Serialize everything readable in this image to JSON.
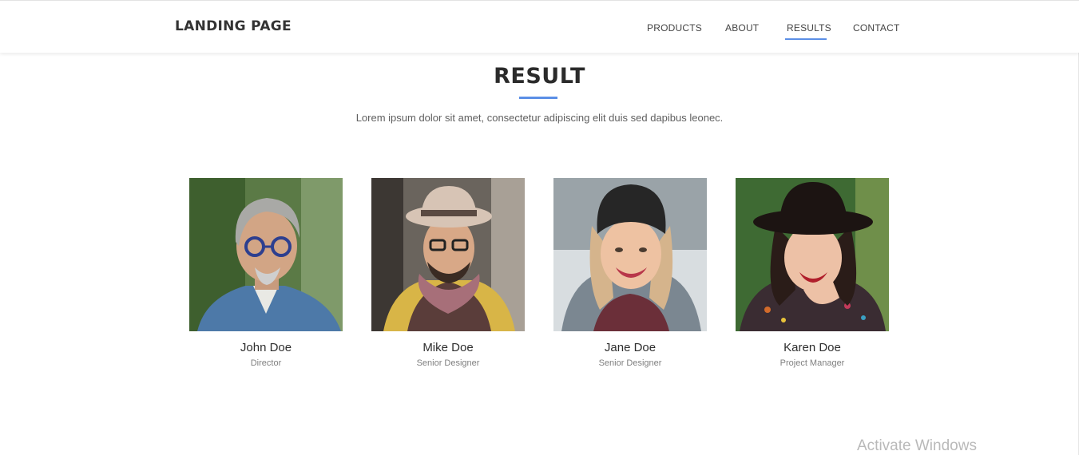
{
  "header": {
    "brand": "LANDING PAGE",
    "nav": [
      {
        "label": "PRODUCTS",
        "active": false
      },
      {
        "label": "ABOUT",
        "active": false
      },
      {
        "label": "RESULTS",
        "active": true
      },
      {
        "label": "CONTACT",
        "active": false
      }
    ],
    "accent_color": "#5b8fe6"
  },
  "section": {
    "title": "RESULT",
    "subtitle": "Lorem ipsum dolor sit amet, consectetur adipiscing elit duis sed dapibus leonec."
  },
  "team": [
    {
      "name": "John Doe",
      "role": "Director",
      "photo_icon": "man-with-glasses-photo"
    },
    {
      "name": "Mike Doe",
      "role": "Senior Designer",
      "photo_icon": "man-with-hat-photo"
    },
    {
      "name": "Jane Doe",
      "role": "Senior Designer",
      "photo_icon": "woman-with-beanie-photo"
    },
    {
      "name": "Karen Doe",
      "role": "Project Manager",
      "photo_icon": "woman-with-hat-photo"
    }
  ],
  "os_overlay": {
    "watermark": "Activate Windows"
  }
}
